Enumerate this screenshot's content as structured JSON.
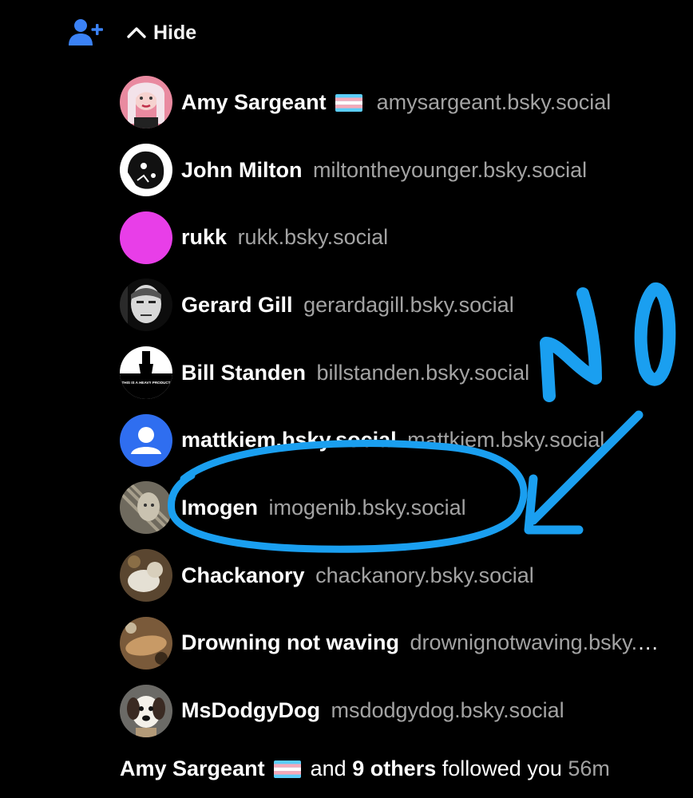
{
  "header": {
    "add_icon": "person-add-icon",
    "hide_label": "Hide",
    "accent": "#3b82f6"
  },
  "followers": [
    {
      "name": "Amy Sargeant",
      "has_flag": true,
      "handle": "amysargeant.bsky.social"
    },
    {
      "name": "John Milton",
      "handle": "miltontheyounger.bsky.social"
    },
    {
      "name": "rukk",
      "handle": "rukk.bsky.social"
    },
    {
      "name": "Gerard Gill",
      "handle": "gerardagill.bsky.social"
    },
    {
      "name": "Bill Standen",
      "handle": "billstanden.bsky.social"
    },
    {
      "name": "mattkiem.bsky.social",
      "handle": "mattkiem.bsky.social"
    },
    {
      "name": "Imogen",
      "handle": "imogenib.bsky.social"
    },
    {
      "name": "Chackanory",
      "handle": "chackanory.bsky.social"
    },
    {
      "name": "Drowning not waving",
      "handle": "drownignotwaving.bsky.social"
    },
    {
      "name": "MsDodgyDog",
      "handle": "msdodgydog.bsky.social"
    }
  ],
  "avatars": {
    "bill_standen_caption": "THIS IS A HEAVY PRODUCT"
  },
  "footer": {
    "name": "Amy Sargeant",
    "and": "and",
    "others": "9 others",
    "followed": "followed you",
    "time": "56m"
  },
  "annotation": {
    "text": "No",
    "color": "#1a9ff0"
  }
}
